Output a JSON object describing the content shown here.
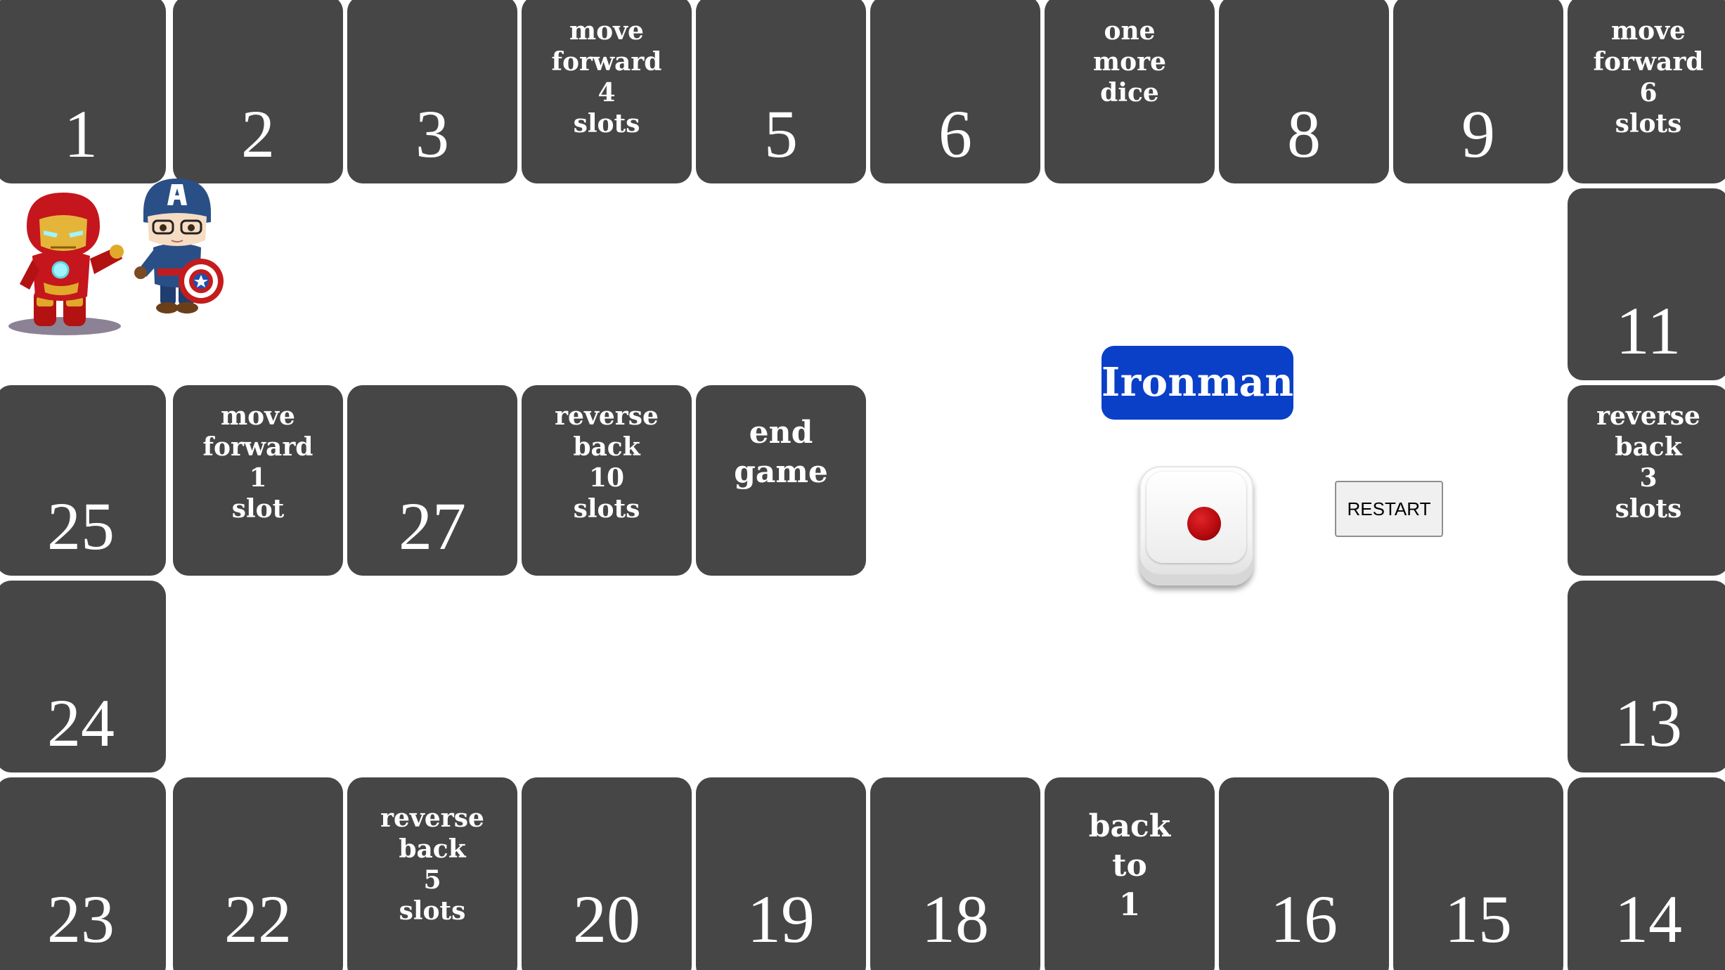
{
  "board": {
    "tiles": [
      {
        "id": 1,
        "number": "1",
        "message": ""
      },
      {
        "id": 2,
        "number": "2",
        "message": ""
      },
      {
        "id": 3,
        "number": "3",
        "message": ""
      },
      {
        "id": 4,
        "number": "",
        "message": "move\nforward\n4\nslots"
      },
      {
        "id": 5,
        "number": "5",
        "message": ""
      },
      {
        "id": 6,
        "number": "6",
        "message": ""
      },
      {
        "id": 7,
        "number": "",
        "message": "one\nmore\ndice"
      },
      {
        "id": 8,
        "number": "8",
        "message": ""
      },
      {
        "id": 9,
        "number": "9",
        "message": ""
      },
      {
        "id": 10,
        "number": "",
        "message": "move\nforward\n6\nslots"
      },
      {
        "id": 11,
        "number": "11",
        "message": ""
      },
      {
        "id": 12,
        "number": "",
        "message": "reverse\nback\n3\nslots"
      },
      {
        "id": 13,
        "number": "13",
        "message": ""
      },
      {
        "id": 14,
        "number": "14",
        "message": ""
      },
      {
        "id": 15,
        "number": "15",
        "message": ""
      },
      {
        "id": 16,
        "number": "16",
        "message": ""
      },
      {
        "id": 17,
        "number": "",
        "message": "back\nto\n1"
      },
      {
        "id": 18,
        "number": "18",
        "message": ""
      },
      {
        "id": 19,
        "number": "19",
        "message": ""
      },
      {
        "id": 20,
        "number": "20",
        "message": ""
      },
      {
        "id": 21,
        "number": "",
        "message": "reverse\nback\n5\nslots"
      },
      {
        "id": 22,
        "number": "22",
        "message": ""
      },
      {
        "id": 23,
        "number": "23",
        "message": ""
      },
      {
        "id": 24,
        "number": "24",
        "message": ""
      },
      {
        "id": 25,
        "number": "25",
        "message": ""
      },
      {
        "id": 26,
        "number": "",
        "message": "move\nforward\n1\nslot"
      },
      {
        "id": 27,
        "number": "27",
        "message": ""
      },
      {
        "id": 28,
        "number": "",
        "message": "reverse\nback\n10\nslots"
      },
      {
        "id": 29,
        "number": "",
        "message": "end\ngame"
      }
    ]
  },
  "players": [
    {
      "name": "Ironman",
      "icon": "ironman-token-icon"
    },
    {
      "name": "Captain America",
      "icon": "captain-america-token-icon"
    }
  ],
  "status": {
    "current_player": "Ironman",
    "badge_color": "#0a3fc8"
  },
  "dice": {
    "value": 1,
    "pip_color": "#c0101a"
  },
  "controls": {
    "restart_label": "RESTART"
  },
  "colors": {
    "tile": "#464646",
    "tile_text": "#ffffff",
    "background": "#ffffff"
  }
}
